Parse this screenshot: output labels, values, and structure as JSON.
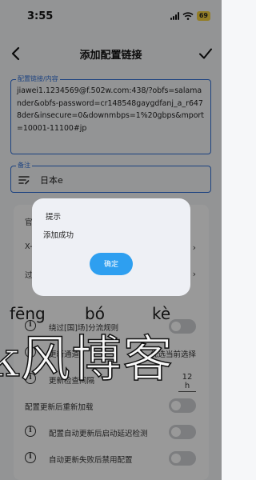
{
  "status_bar": {
    "time": "3:55",
    "battery": "69"
  },
  "nav": {
    "title": "添加配置链接"
  },
  "url_field": {
    "label": "配置链接/内容",
    "value": "jiawei1.1234569@f.502w.com:438/?obfs=salamander&obfs-password=cr148548gaygdfanj_a_r6478der&insecure=0&downmbps=1%20gbps&mport=10001-11100#jp"
  },
  "remark_field": {
    "label": "备注",
    "value": "日本e"
  },
  "settings": {
    "row1_label": "官",
    "row2_label": "X-",
    "row3_label": "过滤",
    "row4_label": "绕过[国]场]分流规则",
    "row5_label": "更新通道",
    "row5_value": "优选当前选择",
    "row6_label": "更新检查间隔",
    "row6_value": "12 h",
    "row7_label": "配置更新后重新加载",
    "row8_label": "配置自动更新后启动延迟检测",
    "row9_label": "自动更新失败后禁用配置"
  },
  "dialog": {
    "title": "提示",
    "message": "添加成功",
    "confirm_label": "确定"
  },
  "watermark": {
    "pinyin_1": "fēng",
    "pinyin_2": "bó",
    "pinyin_3": "kè",
    "text": "k风博客"
  },
  "colors": {
    "accent": "#2f6fd6",
    "button": "#2e9ff0",
    "battery": "#f5d142"
  }
}
